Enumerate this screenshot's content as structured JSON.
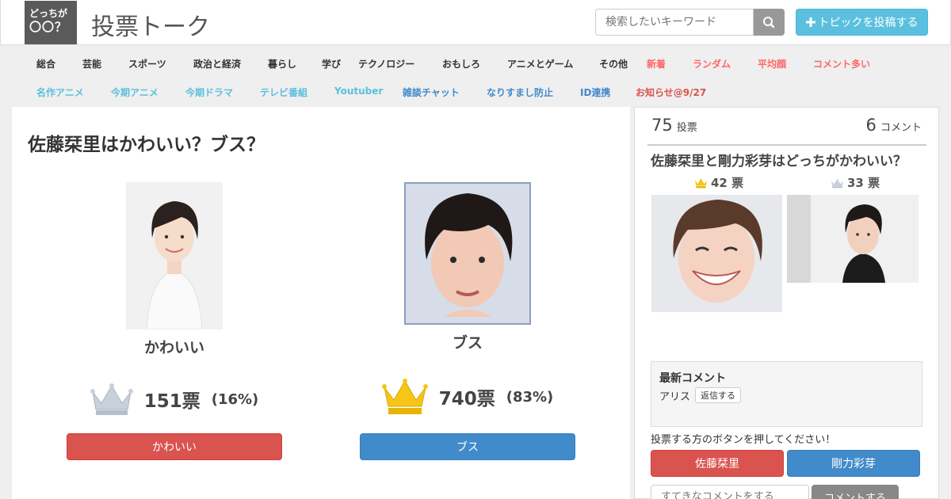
{
  "colors": {
    "accent_red": "#d9534f",
    "accent_blue": "#428bca",
    "info": "#5bc0de",
    "nav_default": "#333333",
    "nav_pink": "#ff6666",
    "nav_cyan": "#5bc0de",
    "nav_link": "#428bca",
    "nav_notice": "#d9534f"
  },
  "header": {
    "logo_line1": "どっちが",
    "logo_line2": "〇〇？",
    "site_title": "投票トーク",
    "search_placeholder": "検索したいキーワード",
    "search_icon": "search-icon",
    "post_icon": "plus-icon",
    "post_label": "トピックを投稿する"
  },
  "nav": {
    "row1": [
      {
        "label": "総合",
        "color": "#333333"
      },
      {
        "label": "芸能",
        "color": "#333333"
      },
      {
        "label": "スポーツ",
        "color": "#333333"
      },
      {
        "label": "政治と経済",
        "color": "#333333"
      },
      {
        "label": "暮らし",
        "color": "#333333"
      },
      {
        "label": "学び",
        "color": "#333333"
      },
      {
        "label": "テクノロジー",
        "color": "#333333"
      },
      {
        "label": "おもしろ",
        "color": "#333333"
      },
      {
        "label": "アニメとゲーム",
        "color": "#333333"
      },
      {
        "label": "その他",
        "color": "#333333"
      },
      {
        "label": "新着",
        "color": "#ff6666"
      },
      {
        "label": "ランダム",
        "color": "#ff6666"
      },
      {
        "label": "平均顔",
        "color": "#ff6666"
      },
      {
        "label": "コメント多い",
        "color": "#ff6666"
      }
    ],
    "row2": [
      {
        "label": "名作アニメ",
        "color": "#5bc0de"
      },
      {
        "label": "今期アニメ",
        "color": "#5bc0de"
      },
      {
        "label": "今期ドラマ",
        "color": "#5bc0de"
      },
      {
        "label": "テレビ番組",
        "color": "#5bc0de"
      },
      {
        "label": "Youtuber",
        "color": "#5bc0de"
      },
      {
        "label": "雑談チャット",
        "color": "#428bca"
      },
      {
        "label": "なりすまし防止",
        "color": "#428bca"
      },
      {
        "label": "ID連携",
        "color": "#428bca"
      },
      {
        "label": "お知らせ@9/27",
        "color": "#d9534f"
      }
    ]
  },
  "main": {
    "title": "佐藤栞里はかわいい？ブス？",
    "options": [
      {
        "label": "かわいい",
        "votes": "151票",
        "percent": "(16%)",
        "button": "かわいい",
        "crown": "silver-crown-icon",
        "share": 0.16
      },
      {
        "label": "ブス",
        "votes": "740票",
        "percent": "(83%)",
        "button": "ブス",
        "crown": "gold-crown-icon",
        "share": 0.83
      }
    ]
  },
  "sidebar": {
    "votes_count": "75",
    "votes_unit": "投票",
    "comments_count": "6",
    "comments_unit": "コメント",
    "topic_title": "佐藤栞里と剛力彩芽はどっちがかわいい？",
    "option_a_votes": "42 票",
    "option_b_votes": "33 票",
    "latest_heading": "最新コメント",
    "latest_author": "アリス",
    "reply_label": "返信する",
    "prompt": "投票する方のボタンを押してください！",
    "option_a_button": "佐藤栞里",
    "option_b_button": "剛力彩芽",
    "comment_placeholder": "すてきなコメントをする",
    "comment_button": "コメントする"
  }
}
